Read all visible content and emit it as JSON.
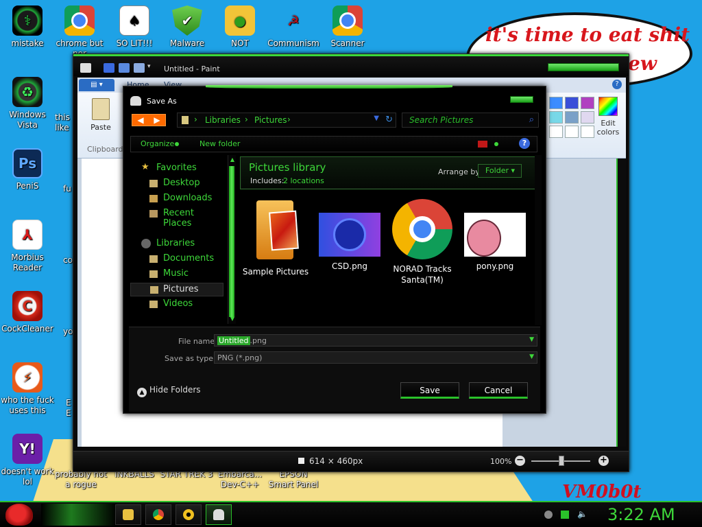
{
  "wallpaper": {
    "bubble_line1": "it's time to eat shit",
    "bubble_line2": "ew",
    "signature": "VM0b0t"
  },
  "desktop_icons": [
    {
      "label": "mistake",
      "icon": "razer-icon"
    },
    {
      "label": "chrome but nor",
      "icon": "chrome-icon"
    },
    {
      "label": "SO LIT!!!",
      "icon": "solitaire-icon"
    },
    {
      "label": "Malware",
      "icon": "shield-icon"
    },
    {
      "label": "NOT",
      "icon": "bad-piggies-icon"
    },
    {
      "label": "Communism",
      "icon": "communism-icon"
    },
    {
      "label": "Scanner",
      "icon": "chrome-icon"
    },
    {
      "label": "Windows Vista",
      "icon": "recycle-bin-icon"
    },
    {
      "label": "this like",
      "icon": "chrome-icon"
    },
    {
      "label": "PeniS",
      "icon": "photoshop-icon"
    },
    {
      "label": "fu",
      "icon": "firefox-icon"
    },
    {
      "label": "Morbius Reader",
      "icon": "pdf-icon"
    },
    {
      "label": "co",
      "icon": "app-icon"
    },
    {
      "label": "CockCleaner",
      "icon": "ccleaner-icon"
    },
    {
      "label": "yo",
      "icon": "app-icon"
    },
    {
      "label": "who the fuck uses this",
      "icon": "avast-icon"
    },
    {
      "label": "E E",
      "icon": "app-icon"
    },
    {
      "label": "doesn't work lol",
      "icon": "yahoo-messenger-icon"
    },
    {
      "label": "probably not a rogue",
      "icon": "app-icon"
    },
    {
      "label": "INKBALLS",
      "icon": "app-icon"
    },
    {
      "label": "STAR TREK 3",
      "icon": "app-icon"
    },
    {
      "label": "Embarca... Dev-C++",
      "icon": "app-icon"
    },
    {
      "label": "EPSON Smart Panel",
      "icon": "app-icon"
    }
  ],
  "paint": {
    "title": "Untitled - Paint",
    "tabs": [
      "Home",
      "View"
    ],
    "paste_label": "Paste",
    "clipboard_label": "Clipboard",
    "edit_colors_label": "Edit colors",
    "palette_colors": [
      "#3c8cff",
      "#3a4fd8",
      "#b040c0",
      "#78d8e8",
      "#7aa0c8",
      "#e0d8f0",
      "#ffffff",
      "#ffffff",
      "#ffffff"
    ],
    "status_dims": "614 × 460px",
    "zoom": "100%"
  },
  "dialog": {
    "title": "Save As",
    "address": [
      "Libraries",
      "Pictures"
    ],
    "search_placeholder": "Search Pictures",
    "organize_label": "Organize",
    "new_folder_label": "New folder",
    "nav": {
      "favorites_label": "Favorites",
      "favorites": [
        "Desktop",
        "Downloads",
        "Recent Places"
      ],
      "libraries_label": "Libraries",
      "libraries": [
        "Documents",
        "Music",
        "Pictures",
        "Videos"
      ]
    },
    "library_title": "Pictures library",
    "includes_label": "Includes:",
    "locations": "2 locations",
    "arrange_label": "Arrange by:",
    "arrange_value": "Folder",
    "files": [
      {
        "name": "Sample Pictures",
        "kind": "folder"
      },
      {
        "name": "CSD.png",
        "kind": "image"
      },
      {
        "name": "NORAD Tracks Santa(TM)",
        "kind": "chrome-shortcut"
      },
      {
        "name": "pony.png",
        "kind": "image"
      }
    ],
    "file_name_label": "File name:",
    "file_name_selected": "Untitled",
    "file_name_rest": ".png",
    "save_type_label": "Save as type:",
    "save_type_value": "PNG (*.png)",
    "hide_folders_label": "Hide Folders",
    "save_label": "Save",
    "cancel_label": "Cancel"
  },
  "taskbar": {
    "clock": "3:22 AM",
    "items": [
      "explorer-icon",
      "chrome-icon",
      "media-icon",
      "paint-icon"
    ]
  }
}
